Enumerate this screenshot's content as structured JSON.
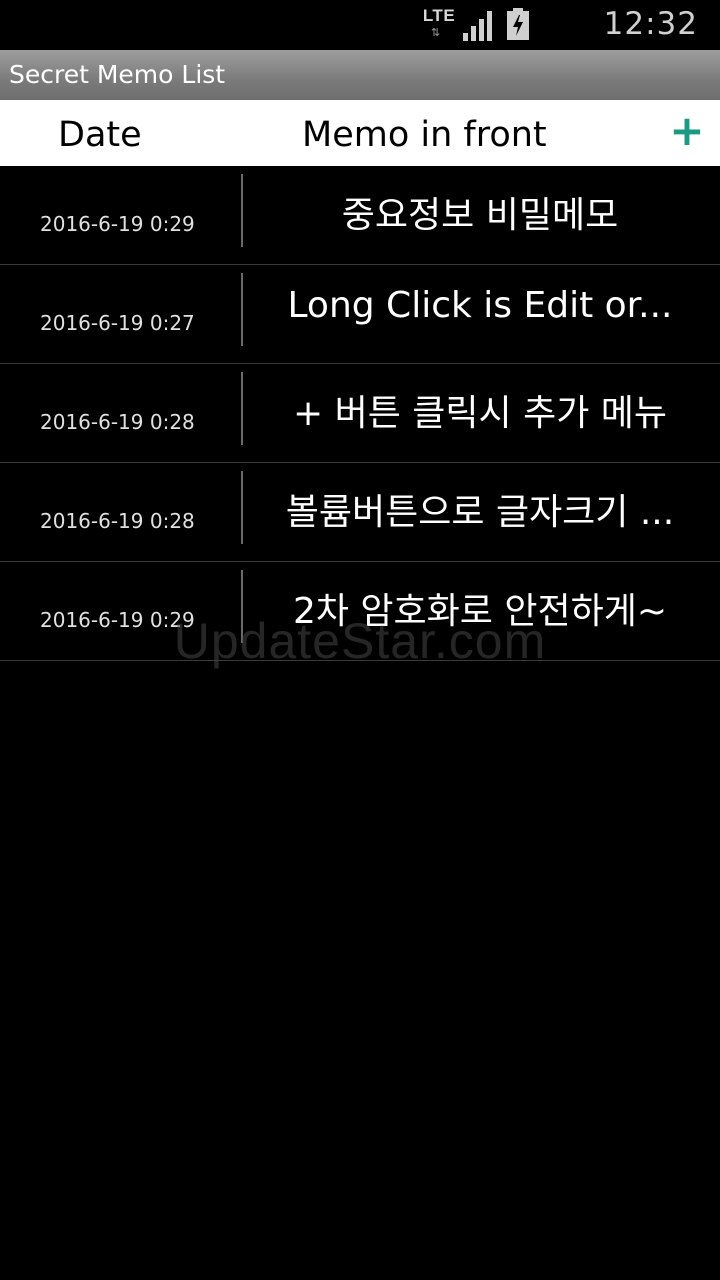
{
  "status_bar": {
    "network": "LTE",
    "data_arrows": "⇅",
    "time": "12:32"
  },
  "app": {
    "title": "Secret Memo List"
  },
  "header": {
    "date_label": "Date",
    "memo_label": "Memo in front",
    "add_symbol": "+"
  },
  "memos": [
    {
      "date": "2016-6-19 0:29",
      "text": "중요정보  비밀메모"
    },
    {
      "date": "2016-6-19 0:27",
      "text": "Long Click  is Edit or..."
    },
    {
      "date": "2016-6-19 0:28",
      "text": "+ 버튼 클릭시 추가 메뉴"
    },
    {
      "date": "2016-6-19 0:28",
      "text": "볼륨버튼으로 글자크기 ..."
    },
    {
      "date": "2016-6-19 0:29",
      "text": "2차 암호화로 안전하게~"
    }
  ],
  "watermark": "UpdateStar.com",
  "colors": {
    "accent": "#1b9a83",
    "background": "#000000",
    "header_bg": "#ffffff",
    "titlebar": "#8a8a8a"
  }
}
